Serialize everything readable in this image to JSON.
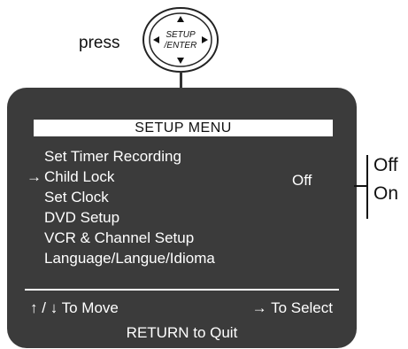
{
  "callout": {
    "press_label": "press",
    "button_line1": "SETUP",
    "button_line2": "/ENTER",
    "button_icon": "dpad-setup-enter-button"
  },
  "osd": {
    "title": "SETUP MENU",
    "items": [
      {
        "label": "Set Timer Recording",
        "selected": false
      },
      {
        "label": "Child Lock",
        "selected": true
      },
      {
        "label": "Set Clock",
        "selected": false
      },
      {
        "label": "DVD Setup",
        "selected": false
      },
      {
        "label": "VCR & Channel Setup",
        "selected": false
      },
      {
        "label": "Language/Langue/Idioma",
        "selected": false
      }
    ],
    "cursor_glyph": "→",
    "selected_value": "Off",
    "help": {
      "move_up": "↑",
      "move_sep": "/",
      "move_down": "↓",
      "move_text": "To Move",
      "select_arrow": "→",
      "select_text": "To Select",
      "quit_text": "RETURN to Quit"
    }
  },
  "options": {
    "values": [
      "Off",
      "On"
    ]
  },
  "colors": {
    "osd_background": "#3b3b3b",
    "osd_text": "#ffffff",
    "page_background": "#ffffff"
  }
}
